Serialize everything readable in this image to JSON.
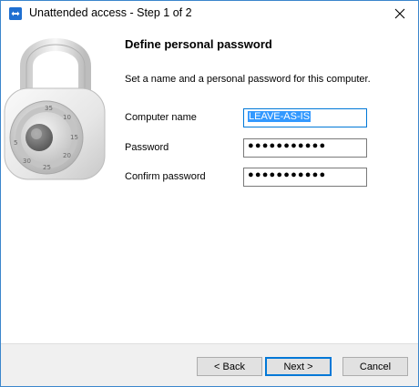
{
  "window": {
    "title": "Unattended access - Step 1 of 2"
  },
  "content": {
    "heading": "Define personal password",
    "description": "Set a name and a personal password for this computer."
  },
  "form": {
    "computer_name": {
      "label": "Computer name",
      "value": "LEAVE-AS-IS"
    },
    "password": {
      "label": "Password",
      "value": "●●●●●●●●●●●"
    },
    "confirm_password": {
      "label": "Confirm password",
      "value": "●●●●●●●●●●●"
    }
  },
  "footer": {
    "back_label": "< Back",
    "next_label": "Next >",
    "cancel_label": "Cancel"
  },
  "colors": {
    "accent": "#0078d7",
    "selection": "#3399ff",
    "footer_bg": "#f0f0f0"
  }
}
